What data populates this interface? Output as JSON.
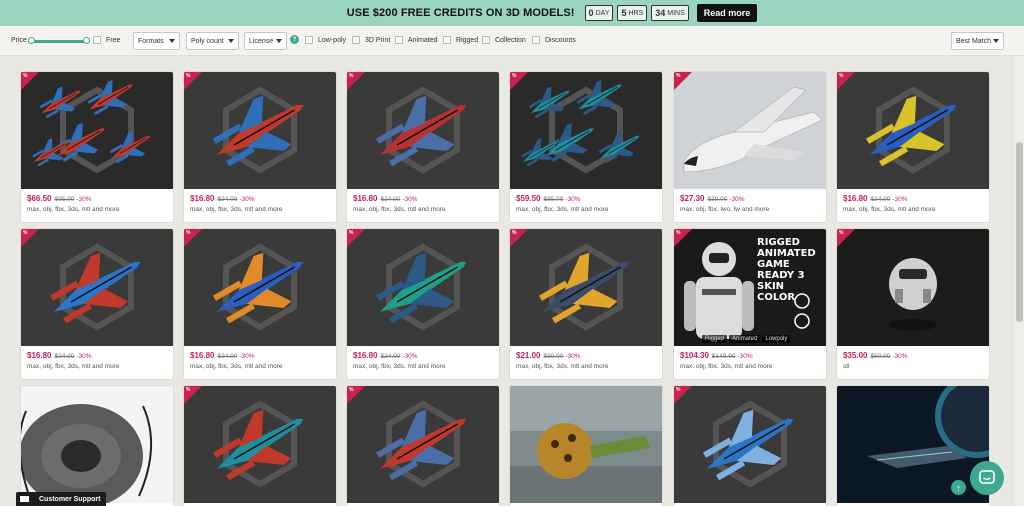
{
  "promo": {
    "text": "USE $200 FREE CREDITS ON 3D MODELS!",
    "countdown": [
      {
        "value": "0",
        "unit": "DAY"
      },
      {
        "value": "5",
        "unit": "HRS"
      },
      {
        "value": "34",
        "unit": "MINS"
      }
    ],
    "read_more": "Read more"
  },
  "filters": {
    "price_label": "Price",
    "price_range": [
      0,
      1
    ],
    "free_label": "Free",
    "formats_label": "Formats",
    "poly_label": "Poly count",
    "license_label": "License",
    "help_glyph": "?",
    "checkboxes": [
      "Low-poly",
      "3D Print",
      "Animated",
      "Rigged",
      "Collection",
      "Discounts"
    ],
    "sort_label": "Best Match"
  },
  "sale_tag": "%",
  "cards": [
    {
      "price": "$66.50",
      "old": "$95.00",
      "off": "-30%",
      "formats": "max, obj, fbx, 3ds, mtl and more",
      "colors": [
        "#c0392b",
        "#2f6fb7"
      ],
      "kind": "fleet",
      "bg": "#2a2a2a"
    },
    {
      "price": "$16.80",
      "old": "$24.00",
      "off": "-30%",
      "formats": "max, obj, fbx, 3ds, mtl and more",
      "colors": [
        "#c0392b",
        "#2f6fb7"
      ],
      "kind": "ship",
      "bg": "#3a3a3a"
    },
    {
      "price": "$16.80",
      "old": "$24.00",
      "off": "-30%",
      "formats": "max, obj, fbx, 3ds, mtl and more",
      "colors": [
        "#b83232",
        "#4a6ea5"
      ],
      "kind": "ship",
      "bg": "#3a3a3a"
    },
    {
      "price": "$59.50",
      "old": "$85.00",
      "off": "-30%",
      "formats": "max, obj, fbx, 3ds, mtl and more",
      "colors": [
        "#1f8e9e",
        "#2c5a86"
      ],
      "kind": "fleet",
      "bg": "#2a2a2a"
    },
    {
      "price": "$27.30",
      "old": "$39.00",
      "off": "-30%",
      "formats": "max, obj, fbx, lwo, lw and more",
      "colors": [
        "#f0f0f0",
        "#222222"
      ],
      "kind": "shuttle",
      "bg": "#cfd3d8"
    },
    {
      "price": "$16.80",
      "old": "$24.00",
      "off": "-30%",
      "formats": "max, obj, fbx, 3ds, mtl and more",
      "colors": [
        "#2a5ec0",
        "#d9c22a"
      ],
      "kind": "ship",
      "bg": "#3a3a3a"
    },
    {
      "price": "$16.80",
      "old": "$24.00",
      "off": "-30%",
      "formats": "max, obj, fbx, 3ds, mtl and more",
      "colors": [
        "#2a76c9",
        "#c0392b"
      ],
      "kind": "ship",
      "bg": "#3a3a3a"
    },
    {
      "price": "$16.80",
      "old": "$24.00",
      "off": "-30%",
      "formats": "max, obj, fbx, 3ds, mtl and more",
      "colors": [
        "#2a5ec0",
        "#e08a2a"
      ],
      "kind": "ship",
      "bg": "#3a3a3a"
    },
    {
      "price": "$16.80",
      "old": "$24.00",
      "off": "-30%",
      "formats": "max, obj, fbx, 3ds, mtl and more",
      "colors": [
        "#1f9e8a",
        "#2c5a86"
      ],
      "kind": "ship",
      "bg": "#3a3a3a"
    },
    {
      "price": "$21.00",
      "old": "$30.00",
      "off": "-30%",
      "formats": "max, obj, fbx, 3ds, mtl and more",
      "colors": [
        "#3b4d6b",
        "#e0a52a"
      ],
      "kind": "ship",
      "bg": "#3a3a3a"
    },
    {
      "price": "$104.30",
      "old": "$149.00",
      "off": "-30%",
      "formats": "max, obj, fbx, 3ds, mtl and more",
      "colors": [
        "#dcdcdc",
        "#555555"
      ],
      "kind": "character",
      "bg": "#1a1a1a",
      "overlay": "RIGGED ANIMATED GAME READY 3 SKIN COLOR",
      "badges": [
        "Rigged",
        "Animated",
        "Lowpoly"
      ]
    },
    {
      "price": "$35.00",
      "old": "$50.00",
      "off": "-30%",
      "formats": "stl",
      "colors": [
        "#cfcfcf",
        "#888888"
      ],
      "kind": "helmet",
      "bg": "#1c1c1c"
    },
    {
      "price": "",
      "old": "",
      "off": "",
      "formats": "",
      "colors": [
        "#5a5a5a",
        "#2a2a2a"
      ],
      "kind": "disc",
      "bg": "#f4f4f4",
      "no_tag": true
    },
    {
      "price": "",
      "old": "",
      "off": "",
      "formats": "",
      "colors": [
        "#1f8e9e",
        "#c0392b"
      ],
      "kind": "ship",
      "bg": "#3a3a3a"
    },
    {
      "price": "",
      "old": "",
      "off": "",
      "formats": "",
      "colors": [
        "#c0392b",
        "#4a6ea5"
      ],
      "kind": "ship",
      "bg": "#3a3a3a"
    },
    {
      "price": "",
      "old": "",
      "off": "",
      "formats": "",
      "colors": [
        "#b8862a",
        "#6b8a3a"
      ],
      "kind": "pod",
      "bg": "#7f8a8a",
      "no_tag": true
    },
    {
      "price": "",
      "old": "",
      "off": "",
      "formats": "",
      "colors": [
        "#2a76c9",
        "#7fb0e0"
      ],
      "kind": "ship",
      "bg": "#3a3a3a"
    },
    {
      "price": "",
      "old": "",
      "off": "",
      "formats": "",
      "colors": [
        "#3aa6c9",
        "#1b2a3a"
      ],
      "kind": "space",
      "bg": "#0b1722",
      "no_tag": true
    }
  ],
  "support": {
    "label": "Customer Support"
  },
  "scroll_top_glyph": "↑"
}
